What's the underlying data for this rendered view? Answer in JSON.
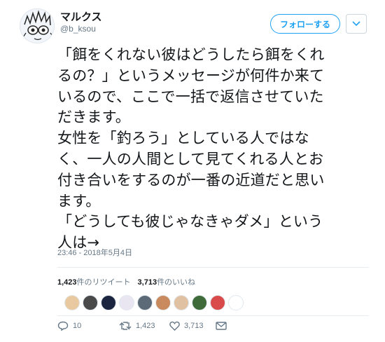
{
  "user": {
    "display_name": "マルクス",
    "screen_name": "@b_ksou"
  },
  "follow_button": {
    "label": "フォローする"
  },
  "tweet": {
    "lines": [
      "「餌をくれない彼はどうしたら餌をくれ",
      "るの？」というメッセージが何件か来て",
      "いるので、ここで一括で返信させていた",
      "だきます。",
      "女性を「釣ろう」としている人ではな",
      "く、一人の人間として見てくれる人とお",
      "付き合いをするのが一番の近道だと思い",
      "ます。",
      "「どうしても彼じゃなきゃダメ」という",
      "人は→"
    ],
    "timestamp": "23:46 - 2018年5月4日"
  },
  "stats": {
    "retweet_count": "1,423",
    "retweet_label": "件のリツイート",
    "like_count": "3,713",
    "like_label": "件のいいね"
  },
  "likers": [
    {
      "icon": "liker-avatar",
      "color": "#e8c9a0"
    },
    {
      "icon": "liker-avatar",
      "color": "#4a4a4a"
    },
    {
      "icon": "liker-avatar",
      "color": "#1b2540"
    },
    {
      "icon": "liker-avatar",
      "color": "#e9e6f2"
    },
    {
      "icon": "liker-avatar",
      "color": "#5c6a78"
    },
    {
      "icon": "liker-avatar",
      "color": "#c98a5e"
    },
    {
      "icon": "liker-avatar",
      "color": "#e0c2a2"
    },
    {
      "icon": "liker-avatar",
      "color": "#3f6b3a"
    },
    {
      "icon": "liker-avatar",
      "color": "#d94a4a"
    },
    {
      "icon": "liker-avatar",
      "color": "#ffffff"
    }
  ],
  "actions": {
    "reply_count": "10",
    "retweet_count": "1,423",
    "like_count": "3,713"
  },
  "colors": {
    "accent": "#1da1f2",
    "muted": "#657786"
  }
}
